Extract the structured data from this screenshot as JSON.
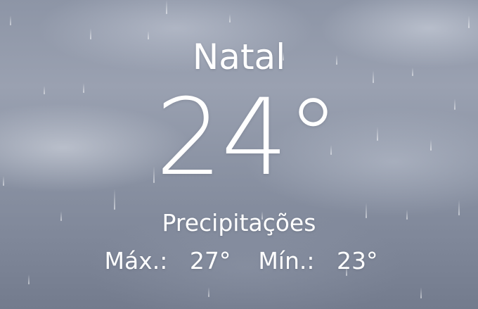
{
  "weather": {
    "city": "Natal",
    "temperature": "24°",
    "condition": "Precipitações",
    "high_label": "Máx.:",
    "high_value": "27°",
    "low_label": "Mín.:",
    "low_value": "23°"
  },
  "background": {
    "scene": "overcast-rain-clouds",
    "tone": "#8d95a6"
  }
}
